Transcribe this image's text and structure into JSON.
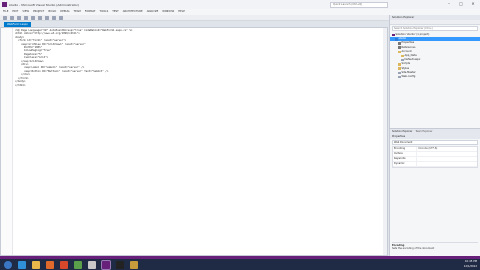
{
  "window": {
    "title": "studio - Microsoft Visual Studio (Administrator)"
  },
  "quick_launch": {
    "placeholder": "Quick Launch (Ctrl+Q)"
  },
  "window_controls": [
    "–",
    "□",
    "✕"
  ],
  "menus": [
    "FILE",
    "EDIT",
    "VIEW",
    "PROJECT",
    "BUILD",
    "DEBUG",
    "TEAM",
    "FORMAT",
    "TOOLS",
    "TEST",
    "ARCHITECTURE",
    "ANALYZE",
    "WINDOW",
    "HELP"
  ],
  "editor": {
    "tab_label": "WebForm1.aspx",
    "lines": [
      "<%@ Page Language=\"C#\" AutoEventWireup=\"true\" CodeBehind=\"WebForm1.aspx.cs\" %>",
      "<html xmlns=\"http://www.w3.org/1999/xhtml\">",
      "<body>",
      "  <form id=\"form1\" runat=\"server\">",
      "    <asp:GridView ID=\"GridView1\" runat=\"server\"",
      "      Width=\"100%\"",
      "      AllowPaging=\"True\"",
      "      PageSize=\"5\"",
      "      CssClass=\"Grid\">",
      "    </asp:GridView>",
      "    <div>",
      "      <asp:Label ID=\"Label1\" runat=\"server\" />",
      "      <asp:Button ID=\"Button1\" runat=\"server\" Text=\"Submit\" />",
      "    </div>",
      "  </form>",
      "</body>",
      "</html>"
    ]
  },
  "solution_explorer": {
    "title": "Solution Explorer",
    "search_placeholder": "Search Solution Explorer (Ctrl+;)",
    "nodes": [
      {
        "label": "Solution 'studio' (1 project)",
        "indent": 0,
        "icon": "solution-icon",
        "selected": false
      },
      {
        "label": "studio",
        "indent": 1,
        "icon": "project-icon",
        "selected": true
      },
      {
        "label": "Properties",
        "indent": 2,
        "icon": "properties-icon",
        "selected": false
      },
      {
        "label": "References",
        "indent": 2,
        "icon": "references-icon",
        "selected": false
      },
      {
        "label": "Account",
        "indent": 2,
        "icon": "folder-icon",
        "selected": false
      },
      {
        "label": "App_Data",
        "indent": 3,
        "icon": "folder-icon",
        "selected": false
      },
      {
        "label": "Default.aspx",
        "indent": 3,
        "icon": "file-icon",
        "selected": false
      },
      {
        "label": "Scripts",
        "indent": 2,
        "icon": "folder-icon",
        "selected": false
      },
      {
        "label": "Styles",
        "indent": 2,
        "icon": "folder-icon",
        "selected": false
      },
      {
        "label": "Site.Master",
        "indent": 2,
        "icon": "file-icon",
        "selected": false
      },
      {
        "label": "Web.config",
        "indent": 2,
        "icon": "file-icon",
        "selected": false
      }
    ]
  },
  "properties": {
    "tabs": [
      "Solution Explorer",
      "Team Explorer"
    ],
    "title": "Properties",
    "object": "Web Document",
    "rows": [
      {
        "key": "Encoding",
        "value": "Unicode (UTF-8)"
      },
      {
        "key": "Culture",
        "value": ""
      },
      {
        "key": "Keywords",
        "value": ""
      },
      {
        "key": "Dynamic",
        "value": ""
      }
    ],
    "desc_title": "Encoding",
    "desc_text": "Sets the encoding of the document"
  },
  "taskbar": {
    "clock_time": "10:45 PM",
    "clock_date": "12/1/2012"
  },
  "colors": {
    "accent": "#007acc",
    "vs_purple": "#68217a",
    "selection": "#3399ff"
  }
}
